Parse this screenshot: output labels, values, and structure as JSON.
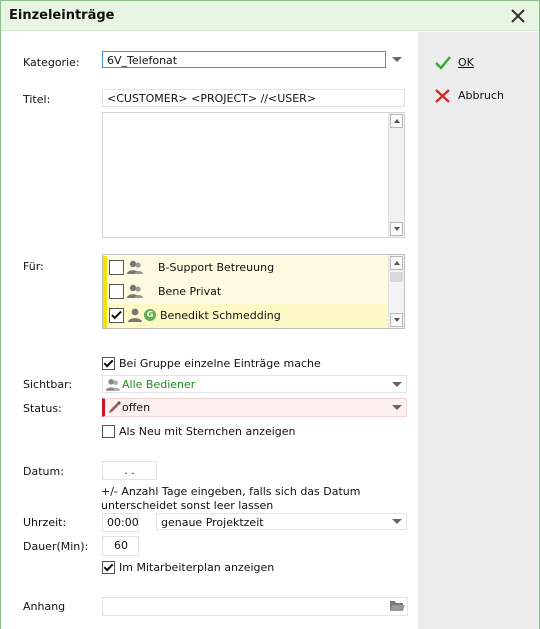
{
  "window": {
    "title": "Einzeleinträge"
  },
  "form": {
    "kategorie_label": "Kategorie:",
    "kategorie_value": "6V_Telefonat",
    "titel_label": "Titel:",
    "titel_value": "<CUSTOMER> <PROJECT> //<USER>",
    "fuer_label": "Für:",
    "fuer_items": [
      {
        "label": "B-Support Betreuung",
        "checked": false,
        "badge": ""
      },
      {
        "label": "Bene Privat",
        "checked": false,
        "badge": ""
      },
      {
        "label": "Benedikt Schmedding",
        "checked": true,
        "badge": "G"
      }
    ],
    "gruppe_check_label": "Bei Gruppe einzelne Einträge mache",
    "gruppe_checked": true,
    "sichtbar_label": "Sichtbar:",
    "sichtbar_value": "Alle Bediener",
    "status_label": "Status:",
    "status_value": "offen",
    "als_neu_label": "Als Neu mit Sternchen anzeigen",
    "als_neu_checked": false,
    "datum_label": "Datum:",
    "datum_value": ". .",
    "datum_hint": "+/- Anzahl Tage eingeben, falls sich das Datum unterscheidet sonst leer lassen",
    "uhrzeit_label": "Uhrzeit:",
    "uhrzeit_value": "00:00",
    "zeit_mode_value": "genaue Projektzeit",
    "dauer_label": "Dauer(Min):",
    "dauer_value": "60",
    "mitarbeiterplan_label": "Im Mitarbeiterplan anzeigen",
    "mitarbeiterplan_checked": true,
    "anhang_label": "Anhang",
    "anhang_value": ""
  },
  "actions": {
    "ok_label": "OK",
    "cancel_label": "Abbruch"
  },
  "colors": {
    "titlebar_bg": "#e8f5e3",
    "sidebar_bg": "#ececec",
    "list_bg": "#fffbe0",
    "list_accent": "#f2e600",
    "status_bg": "#fff0f0",
    "status_accent": "#d0112b",
    "ok_green": "#3aa33a",
    "cancel_red": "#d42a2a",
    "sichtbar_text": "#228b22"
  },
  "icons": [
    "close-icon",
    "check-icon",
    "cross-icon",
    "person-icon",
    "pencil-icon",
    "folder-icon",
    "group-badge-icon"
  ]
}
